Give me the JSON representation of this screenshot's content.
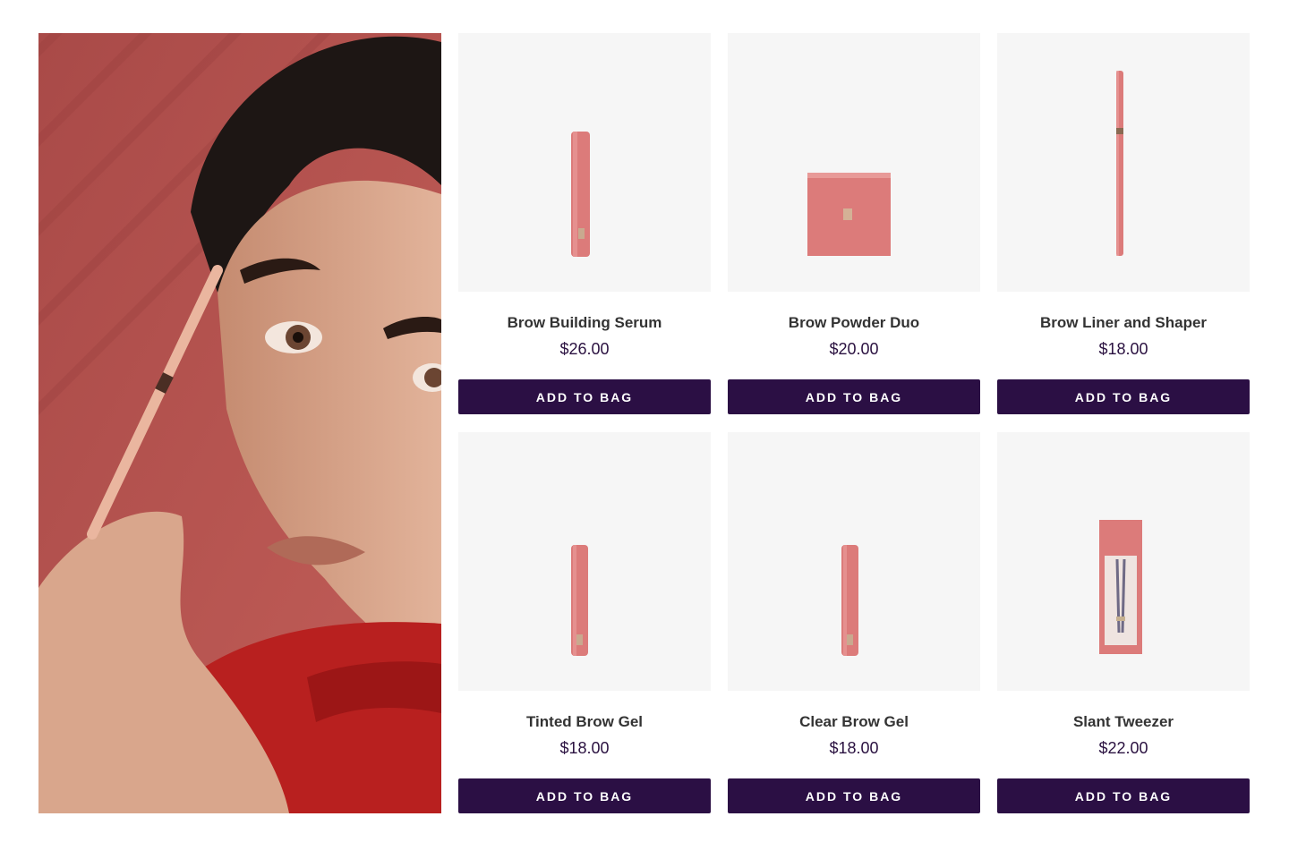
{
  "hero": {
    "image_icon": "model-applying-brow-pencil-photo"
  },
  "products": [
    {
      "name": "Brow Building Serum",
      "price": "$26.00",
      "cta": "ADD TO BAG",
      "image_icon": "serum-tube-icon"
    },
    {
      "name": "Brow Powder Duo",
      "price": "$20.00",
      "cta": "ADD TO BAG",
      "image_icon": "powder-compact-icon"
    },
    {
      "name": "Brow Liner and Shaper",
      "price": "$18.00",
      "cta": "ADD TO BAG",
      "image_icon": "brow-pencil-icon"
    },
    {
      "name": "Tinted Brow Gel",
      "price": "$18.00",
      "cta": "ADD TO BAG",
      "image_icon": "brow-gel-tube-icon"
    },
    {
      "name": "Clear Brow Gel",
      "price": "$18.00",
      "cta": "ADD TO BAG",
      "image_icon": "brow-gel-tube-icon"
    },
    {
      "name": "Slant Tweezer",
      "price": "$22.00",
      "cta": "ADD TO BAG",
      "image_icon": "tweezer-box-icon"
    }
  ],
  "colors": {
    "button_bg": "#2b0f44",
    "price_text": "#2a1140",
    "product_pink": "#dc7b7a",
    "tile_bg": "#f6f6f6"
  }
}
